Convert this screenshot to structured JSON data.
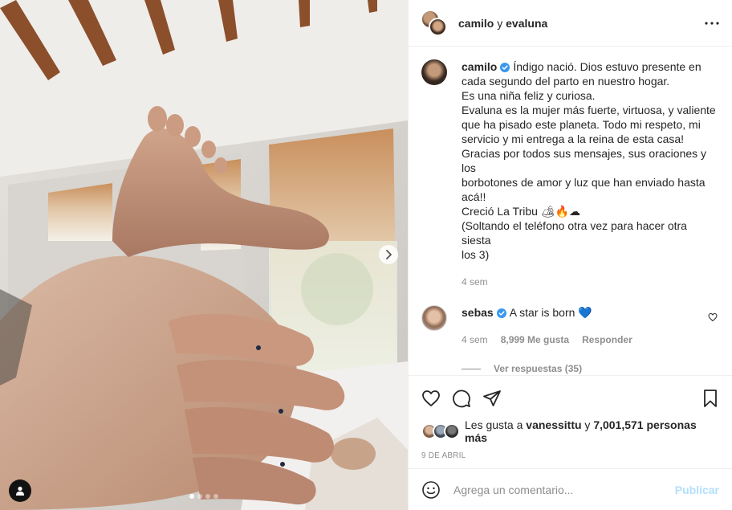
{
  "header": {
    "user1": "camilo",
    "conjunction": "y",
    "user2": "evaluna",
    "more_icon": "more-horizontal-icon"
  },
  "caption": {
    "username": "camilo",
    "lines": [
      "Índigo nació. Dios estuvo presente en",
      "cada segundo del parto en nuestro hogar.",
      "Es una niña feliz y curiosa.",
      "Evaluna es la mujer más fuerte, virtuosa, y valiente",
      "que ha pisado este planeta. Todo mi respeto, mi",
      "servicio y mi entrega a la reina de esta casa!",
      "Gracias por todos sus mensajes, sus oraciones y los",
      "borbotones de amor y luz que han enviado hasta",
      "acá!!",
      "Creció La Tribu 🏕🔥☁",
      "(Soltando el teléfono otra vez para hacer otra siesta",
      "los 3)"
    ],
    "time": "4 sem"
  },
  "comment": {
    "username": "sebas",
    "text": "A star is born 💙",
    "time": "4 sem",
    "likes": "8,999 Me gusta",
    "reply_label": "Responder",
    "view_replies": "Ver respuestas (35)"
  },
  "likes": {
    "prefix": "Les gusta a",
    "user": "vanessittu",
    "connector": "y",
    "others": "7,001,571 personas más"
  },
  "date": "9 DE ABRIL",
  "add_comment": {
    "placeholder": "Agrega un comentario...",
    "publish_label": "Publicar"
  },
  "carousel": {
    "total": 4,
    "active": 0
  },
  "colors": {
    "verified": "#3897f0",
    "publish_disabled": "#b2dffc",
    "secondary_text": "#8e8e8e",
    "border": "#efefef",
    "heart_emoji": "#1f5fbf"
  }
}
